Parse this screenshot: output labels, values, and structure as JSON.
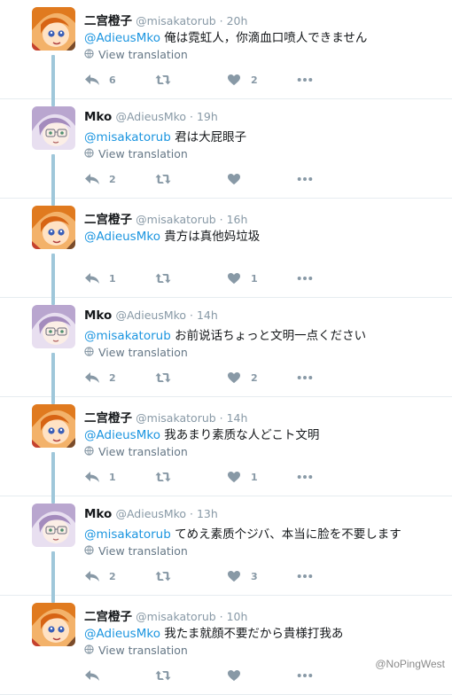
{
  "colors": {
    "mention": "#1b95e0",
    "meta": "#8899a6",
    "thread_line": "#9fc7da"
  },
  "tweets": [
    {
      "name": "二宫橙子",
      "handle": "@misakatorub",
      "time": "20h",
      "mention": "@AdieusMko",
      "text": " 俺は霓虹人，你滴血口喷人できません",
      "translate": "View translation",
      "reply_count": "6",
      "retweet_count": "",
      "like_count": "2",
      "avatar": "orange-hair-avatar"
    },
    {
      "name": "Mko",
      "handle": "@AdieusMko",
      "time": "19h",
      "mention": "@misakatorub",
      "text": " 君は大屁眼子",
      "translate": "View translation",
      "reply_count": "2",
      "retweet_count": "",
      "like_count": "",
      "avatar": "purple-hair-avatar"
    },
    {
      "name": "二宫橙子",
      "handle": "@misakatorub",
      "time": "16h",
      "mention": "@AdieusMko",
      "text": " 貴方は真他妈垃圾",
      "translate": "",
      "reply_count": "1",
      "retweet_count": "",
      "like_count": "1",
      "avatar": "orange-hair-avatar"
    },
    {
      "name": "Mko",
      "handle": "@AdieusMko",
      "time": "14h",
      "mention": "@misakatorub",
      "text": " お前说话ちょっと文明一点ください",
      "translate": "View translation",
      "reply_count": "2",
      "retweet_count": "",
      "like_count": "2",
      "avatar": "purple-hair-avatar"
    },
    {
      "name": "二宫橙子",
      "handle": "@misakatorub",
      "time": "14h",
      "mention": "@AdieusMko",
      "text": " 我あまり素质な人どこト文明",
      "translate": "View translation",
      "reply_count": "1",
      "retweet_count": "",
      "like_count": "1",
      "avatar": "orange-hair-avatar"
    },
    {
      "name": "Mko",
      "handle": "@AdieusMko",
      "time": "13h",
      "mention": "@misakatorub",
      "text": " てめえ素质个ジバ、本当に脸を不要します",
      "translate": "View translation",
      "reply_count": "2",
      "retweet_count": "",
      "like_count": "3",
      "avatar": "purple-hair-avatar"
    },
    {
      "name": "二宫橙子",
      "handle": "@misakatorub",
      "time": "10h",
      "mention": "@AdieusMko",
      "text": " 我たま就顔不要だから貴様打我あ",
      "translate": "View translation",
      "reply_count": "",
      "retweet_count": "",
      "like_count": "",
      "avatar": "orange-hair-avatar"
    }
  ],
  "watermark": "@NoPingWest"
}
